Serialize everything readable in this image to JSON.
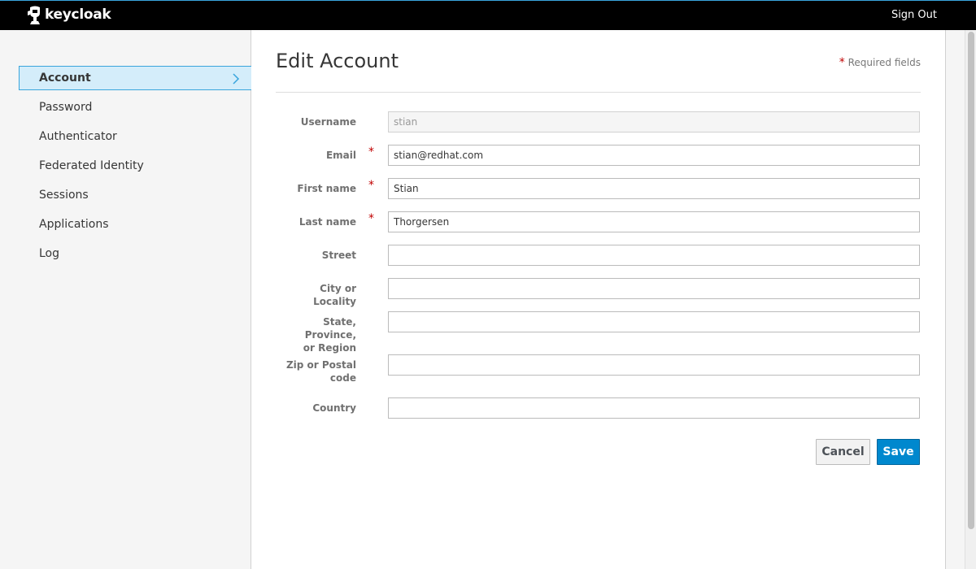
{
  "header": {
    "brand": "keycloak",
    "sign_out": "Sign Out"
  },
  "sidebar": {
    "items": [
      {
        "label": "Account",
        "active": true
      },
      {
        "label": "Password"
      },
      {
        "label": "Authenticator"
      },
      {
        "label": "Federated Identity"
      },
      {
        "label": "Sessions"
      },
      {
        "label": "Applications"
      },
      {
        "label": "Log"
      }
    ]
  },
  "main": {
    "title": "Edit Account",
    "required_star": "*",
    "required_note": "Required fields",
    "fields": [
      {
        "label": "Username",
        "value": "stian",
        "required": false,
        "readonly": true
      },
      {
        "label": "Email",
        "value": "stian@redhat.com",
        "required": true
      },
      {
        "label": "First name",
        "value": "Stian",
        "required": true
      },
      {
        "label": "Last name",
        "value": "Thorgersen",
        "required": true
      },
      {
        "label": "Street",
        "value": "",
        "required": false
      },
      {
        "label": "City or Locality",
        "value": "",
        "required": false
      },
      {
        "label_line1": "State, Province,",
        "label_line2": "or Region",
        "value": "",
        "required": false
      },
      {
        "label_line1": "Zip or Postal",
        "label_line2": "code",
        "value": "",
        "required": false
      },
      {
        "label": "Country",
        "value": "",
        "required": false
      }
    ],
    "cancel_label": "Cancel",
    "save_label": "Save"
  },
  "colors": {
    "accent": "#39a5dc",
    "primary_button": "#0088ce",
    "required": "#c00000",
    "header_bg": "#000000"
  }
}
